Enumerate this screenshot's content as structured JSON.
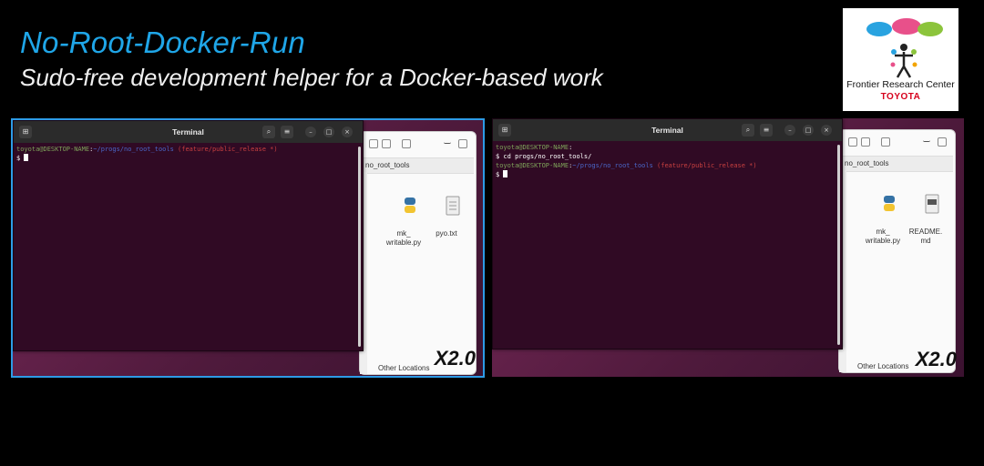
{
  "header": {
    "title": "No-Root-Docker-Run",
    "subtitle": "Sudo-free development helper for a Docker-based work"
  },
  "logo": {
    "line1": "Frontier Research Center",
    "line2": "TOYOTA"
  },
  "panels": [
    {
      "terminal": {
        "title": "Terminal",
        "lines": [
          {
            "user": "toyota@DESKTOP-NAME",
            "sep": ":",
            "path": "~/progs/no_root_tools",
            "branch": " (feature/public_release *)"
          },
          {
            "prompt": "$ "
          }
        ]
      },
      "files": {
        "path": "no_root_tools",
        "file1": "mk_\nwritable.py",
        "file2": "pyo.txt",
        "other_locations": "Other Locations"
      },
      "speed": "X2.0"
    },
    {
      "terminal": {
        "title": "Terminal",
        "lines": [
          {
            "user": "toyota@DESKTOP-NAME",
            "sep": ":"
          },
          {
            "cmd": "$ cd progs/no_root_tools/"
          },
          {
            "user": "toyota@DESKTOP-NAME",
            "sep": ":",
            "path": "~/progs/no_root_tools",
            "branch": " (feature/public_release *)"
          },
          {
            "prompt": "$ "
          }
        ]
      },
      "files": {
        "path": "no_root_tools",
        "file1": "mk_\nwritable.py",
        "file2": "README.\nmd",
        "other_locations": "Other Locations"
      },
      "speed": "X2.0"
    }
  ]
}
